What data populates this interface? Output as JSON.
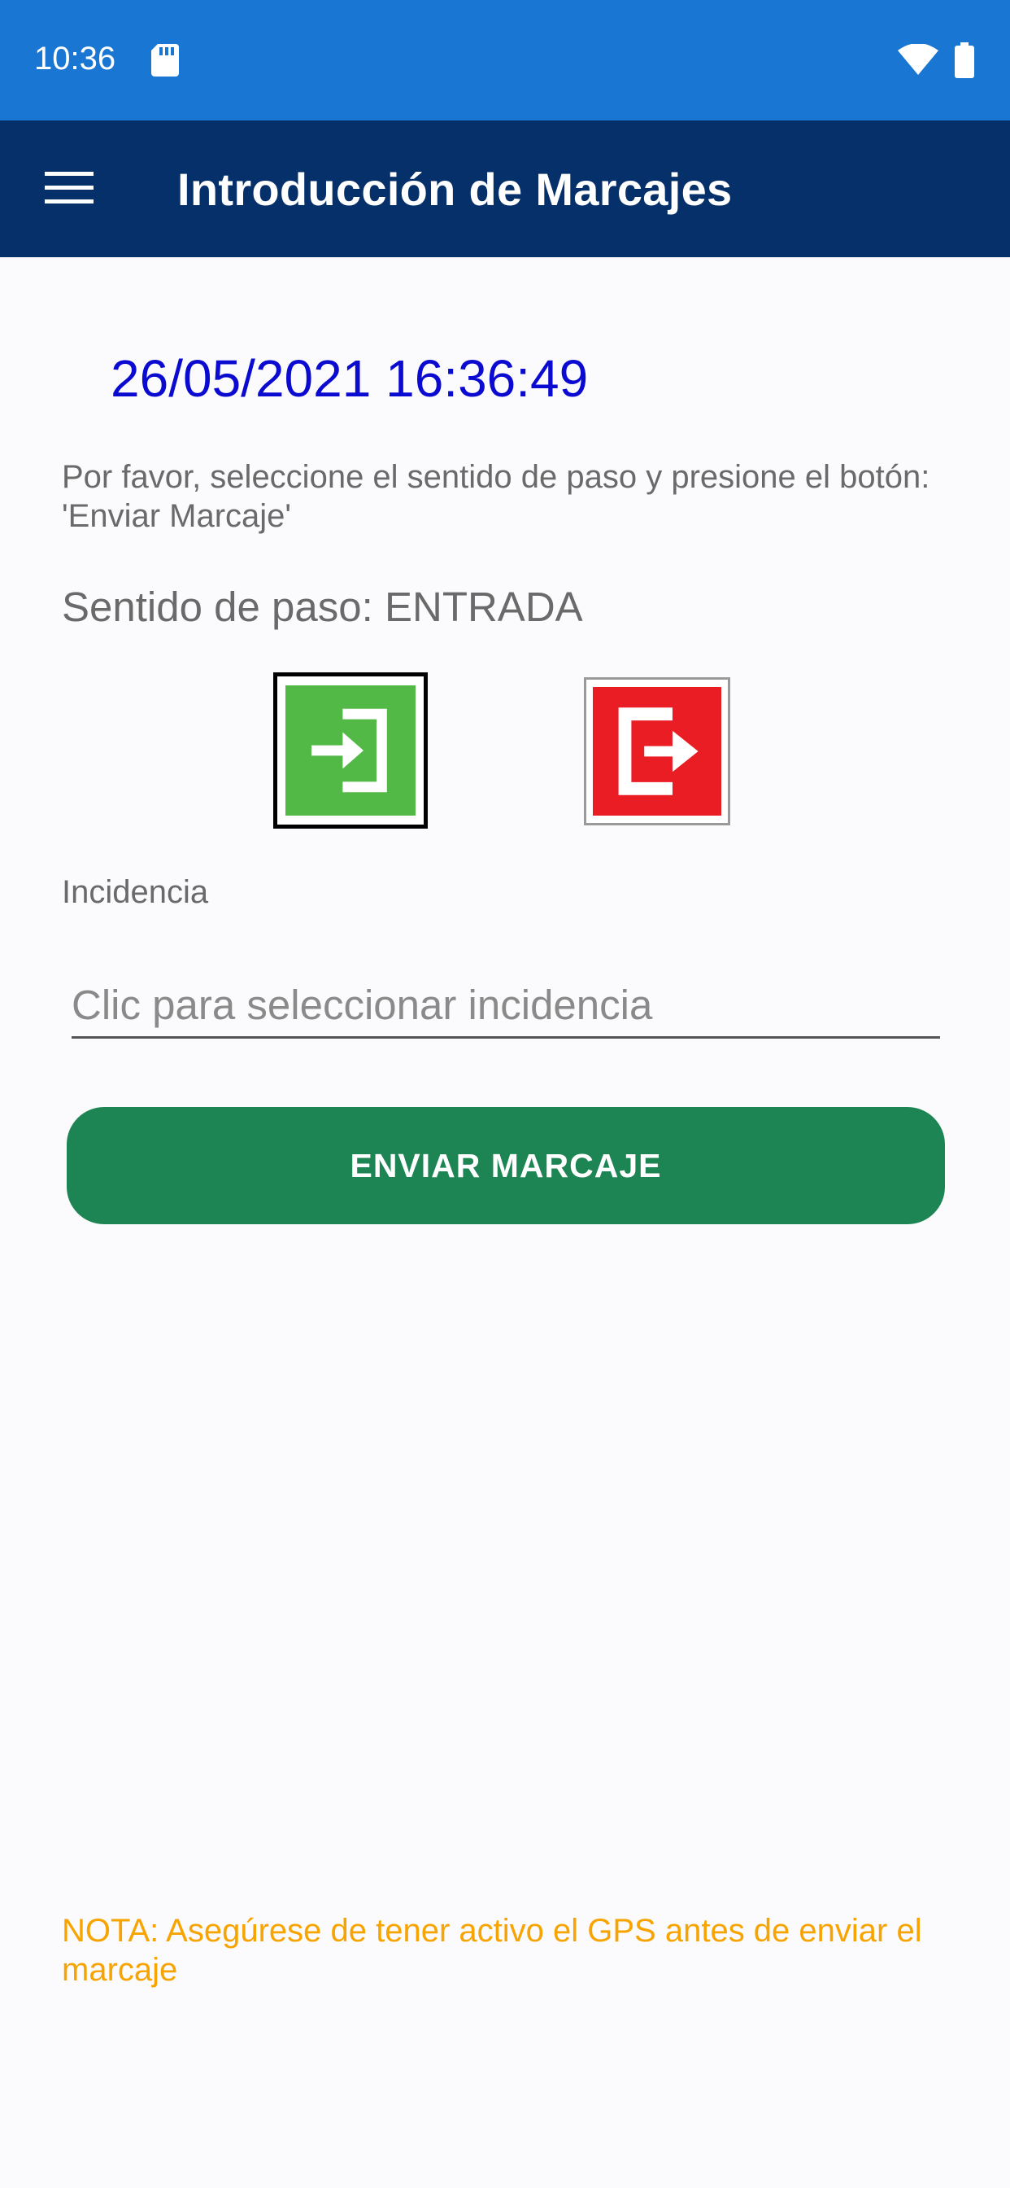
{
  "status_bar": {
    "time": "10:36",
    "icons": [
      "sd-card-icon",
      "wifi-icon",
      "battery-icon"
    ],
    "background": "#1976d2"
  },
  "app_bar": {
    "title": "Introducción de Marcajes",
    "menu_icon": "hamburger-menu-icon",
    "background": "#06306a"
  },
  "main": {
    "datetime": "26/05/2021 16:36:49",
    "instructions": "Por favor, seleccione el sentido de paso y presione el botón: 'Enviar Marcaje'",
    "direction_label": "Sentido de paso: ENTRADA",
    "direction_buttons": [
      {
        "name": "entrada",
        "icon": "login-arrow-icon",
        "color": "#52b947",
        "selected": true
      },
      {
        "name": "salida",
        "icon": "logout-arrow-icon",
        "color": "#ea1c24",
        "selected": false
      }
    ],
    "incidencia_label": "Incidencia",
    "incidencia_placeholder": "Clic para seleccionar incidencia",
    "incidencia_value": "",
    "send_button_label": "ENVIAR MARCAJE",
    "send_button_color": "#1d8553",
    "note": "NOTA: Asegúrese de tener activo el GPS antes de enviar el marcaje",
    "note_color": "#f7a400",
    "datetime_color": "#0a0ad0"
  }
}
